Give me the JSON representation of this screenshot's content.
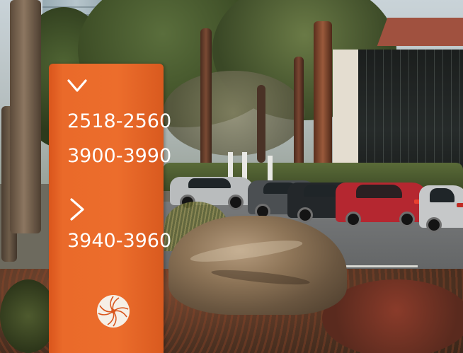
{
  "sign": {
    "down_arrow_icon": "chevron-down-icon",
    "right_arrow_icon": "chevron-right-icon",
    "range_1": "2518-2560",
    "range_2": "3900-3990",
    "range_3": "3940-3960",
    "emblem_icon": "flower-emblem-icon",
    "color": "#ec6d2c",
    "text_color": "#ffffff"
  }
}
